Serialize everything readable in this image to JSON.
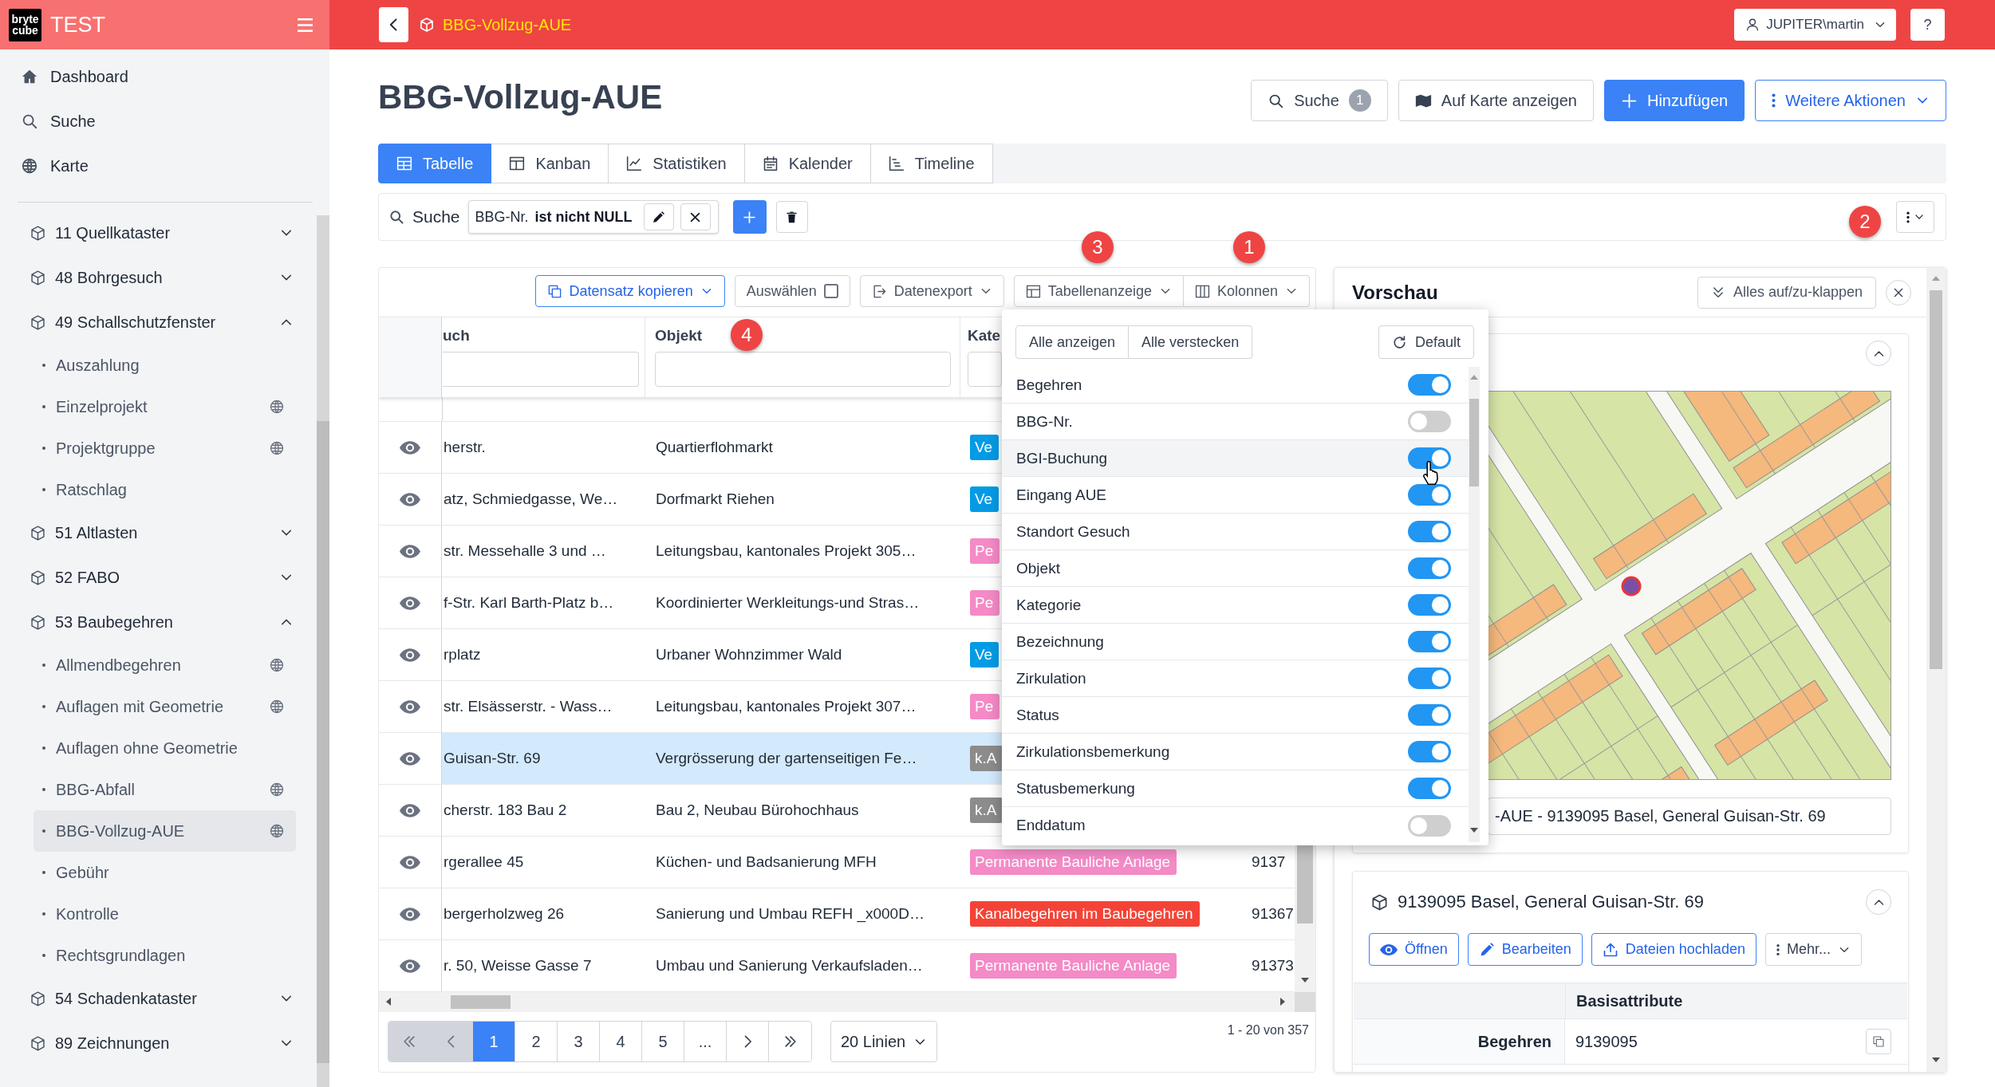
{
  "sidebar": {
    "logo": {
      "top": "bryte",
      "bottom": "cube"
    },
    "app_name": "TEST",
    "nav": [
      {
        "label": "Dashboard",
        "kind": "home"
      },
      {
        "label": "Suche",
        "kind": "search"
      },
      {
        "label": "Karte",
        "kind": "globe"
      }
    ],
    "groups": [
      {
        "label": "11 Quellkataster",
        "expanded": false
      },
      {
        "label": "48 Bohrgesuch",
        "expanded": false
      },
      {
        "label": "49 Schallschutzfenster",
        "expanded": true,
        "children": [
          {
            "label": "Auszahlung",
            "geo": false,
            "selected": false
          },
          {
            "label": "Einzelprojekt",
            "geo": true,
            "selected": false
          },
          {
            "label": "Projektgruppe",
            "geo": true,
            "selected": false
          },
          {
            "label": "Ratschlag",
            "geo": false,
            "selected": false
          }
        ]
      },
      {
        "label": "51 Altlasten",
        "expanded": false
      },
      {
        "label": "52 FABO",
        "expanded": false
      },
      {
        "label": "53 Baubegehren",
        "expanded": true,
        "children": [
          {
            "label": "Allmendbegehren",
            "geo": true,
            "selected": false
          },
          {
            "label": "Auflagen mit Geometrie",
            "geo": true,
            "selected": false
          },
          {
            "label": "Auflagen ohne Geometrie",
            "geo": false,
            "selected": false
          },
          {
            "label": "BBG-Abfall",
            "geo": true,
            "selected": false
          },
          {
            "label": "BBG-Vollzug-AUE",
            "geo": true,
            "selected": true
          },
          {
            "label": "Gebühr",
            "geo": false,
            "selected": false
          },
          {
            "label": "Kontrolle",
            "geo": false,
            "selected": false
          },
          {
            "label": "Rechtsgrundlagen",
            "geo": false,
            "selected": false
          }
        ]
      },
      {
        "label": "54 Schadenkataster",
        "expanded": false
      },
      {
        "label": "89 Zeichnungen",
        "expanded": false
      }
    ]
  },
  "topbar": {
    "title": "BBG-Vollzug-AUE",
    "user": "JUPITER\\martin",
    "help": "?"
  },
  "page": {
    "title": "BBG-Vollzug-AUE",
    "actions": [
      {
        "label": "Suche",
        "kind": "search",
        "badge": "1"
      },
      {
        "label": "Auf Karte anzeigen",
        "kind": "map"
      },
      {
        "label": "Hinzufügen",
        "kind": "add"
      },
      {
        "label": "Weitere Aktionen",
        "kind": "more"
      }
    ]
  },
  "tabs": [
    {
      "label": "Tabelle",
      "kind": "table",
      "selected": true
    },
    {
      "label": "Kanban",
      "kind": "kanban",
      "selected": false
    },
    {
      "label": "Statistiken",
      "kind": "chart",
      "selected": false
    },
    {
      "label": "Kalender",
      "kind": "calendar",
      "selected": false
    },
    {
      "label": "Timeline",
      "kind": "timeline",
      "selected": false
    }
  ],
  "search_bar": {
    "label": "Suche",
    "filters": [
      {
        "field": "BBG-Nr.",
        "condition": "ist nicht NULL"
      }
    ]
  },
  "markers": [
    {
      "label": "2"
    },
    {
      "label": "3"
    },
    {
      "label": "1"
    },
    {
      "label": "4"
    }
  ],
  "table": {
    "toolbar": [
      {
        "label": "Datensatz kopieren",
        "kind": "copy"
      },
      {
        "label": "Auswählen",
        "kind": "select",
        "checked": false
      },
      {
        "label": "Datenexport",
        "kind": "export"
      },
      {
        "label": "Tabellenanzeige",
        "kind": "view"
      },
      {
        "label": "Kolonnen",
        "kind": "columns"
      }
    ],
    "columns": [
      {
        "label": "uch"
      },
      {
        "label": "Objekt"
      },
      {
        "label": "Kate"
      }
    ],
    "rows": [
      {
        "selected": false,
        "column_1": "herstr.",
        "objekt": "Quartierflohmarkt",
        "kategorie": {
          "label": "Ve",
          "color": "#039be5"
        }
      },
      {
        "selected": false,
        "column_1": "atz, Schmiedgasse, We…",
        "objekt": "Dorfmarkt Riehen",
        "kategorie": {
          "label": "Ve",
          "color": "#039be5"
        }
      },
      {
        "selected": false,
        "column_1": "str. Messehalle 3 und …",
        "objekt": "Leitungsbau, kantonales Projekt 305…",
        "kategorie": {
          "label": "Pe",
          "color": "#f48ac6"
        }
      },
      {
        "selected": false,
        "column_1": "f-Str. Karl Barth-Platz b…",
        "objekt": "Koordinierter Werkleitungs-und Stras…",
        "kategorie": {
          "label": "Pe",
          "color": "#f48ac6"
        }
      },
      {
        "selected": false,
        "column_1": "rplatz",
        "objekt": "Urbaner Wohnzimmer Wald",
        "kategorie": {
          "label": "Ve",
          "color": "#039be5"
        }
      },
      {
        "selected": false,
        "column_1": "str. Elsässerstr. - Wass…",
        "objekt": "Leitungsbau, kantonales Projekt 307…",
        "kategorie": {
          "label": "Pe",
          "color": "#f48ac6"
        }
      },
      {
        "selected": true,
        "column_1": "Guisan-Str. 69",
        "objekt": "Vergrösserung der gartenseitigen Fe…",
        "kategorie": {
          "label": "k.A",
          "color": "#8c8c8c"
        }
      },
      {
        "selected": false,
        "column_1": "cherstr. 183 Bau 2",
        "objekt": "Bau 2, Neubau Bürohochhaus",
        "kategorie": {
          "label": "k.A",
          "color": "#8c8c8c"
        }
      },
      {
        "selected": false,
        "column_1": "rgerallee 45",
        "objekt": "Küchen- und Badsanierung MFH",
        "kategorie": {
          "label": "Permanente Bauliche Anlage",
          "color": "#f48ac6"
        },
        "column_4": "9137"
      },
      {
        "selected": false,
        "column_1": "bergerholzweg 26",
        "objekt": "Sanierung und Umbau REFH _x000D…",
        "kategorie": {
          "label": "Kanalbegehren im Baubegehren",
          "color": "#f44336"
        },
        "column_4": "91367"
      },
      {
        "selected": false,
        "column_1": "r. 50, Weisse Gasse 7",
        "objekt": "Umbau und Sanierung Verkaufsladen…",
        "kategorie": {
          "label": "Permanente Bauliche Anlage",
          "color": "#f48ac6"
        },
        "column_4": "91373"
      }
    ],
    "pagination": {
      "first": {
        "disabled": true
      },
      "prev": {
        "disabled": true
      },
      "pages": [
        {
          "label": "1",
          "selected": true
        },
        {
          "label": "2",
          "selected": false
        },
        {
          "label": "3",
          "selected": false
        },
        {
          "label": "4",
          "selected": false
        },
        {
          "label": "5",
          "selected": false
        },
        {
          "label": "...",
          "selected": false
        }
      ],
      "next": {
        "disabled": false
      },
      "last": {
        "disabled": false
      },
      "page_size": "20 Linien",
      "summary": "1 - 20 von 357"
    }
  },
  "columns_menu": {
    "show_all": "Alle anzeigen",
    "hide_all": "Alle verstecken",
    "reset": "Default",
    "items": [
      {
        "label": "Begehren",
        "on": true,
        "hovered": false
      },
      {
        "label": "BBG-Nr.",
        "on": false,
        "hovered": false
      },
      {
        "label": "BGI-Buchung",
        "on": true,
        "hovered": true
      },
      {
        "label": "Eingang AUE",
        "on": true,
        "hovered": false
      },
      {
        "label": "Standort Gesuch",
        "on": true,
        "hovered": false
      },
      {
        "label": "Objekt",
        "on": true,
        "hovered": false
      },
      {
        "label": "Kategorie",
        "on": true,
        "hovered": false
      },
      {
        "label": "Bezeichnung",
        "on": true,
        "hovered": false
      },
      {
        "label": "Zirkulation",
        "on": true,
        "hovered": false
      },
      {
        "label": "Status",
        "on": true,
        "hovered": false
      },
      {
        "label": "Zirkulationsbemerkung",
        "on": true,
        "hovered": false
      },
      {
        "label": "Statusbemerkung",
        "on": true,
        "hovered": false
      },
      {
        "label": "Enddatum",
        "on": false,
        "hovered": false
      }
    ]
  },
  "preview": {
    "title": "Vorschau",
    "toggle_all": "Alles auf/zu-klappen",
    "map_card": {
      "expanded": true,
      "caption": "-AUE - 9139095 Basel, General Guisan-Str. 69"
    },
    "record": {
      "expanded": true,
      "title": "9139095 Basel, General Guisan-Str. 69",
      "actions": [
        {
          "label": "Öffnen",
          "kind": "open"
        },
        {
          "label": "Bearbeiten",
          "kind": "edit"
        },
        {
          "label": "Dateien hochladen",
          "kind": "upload"
        },
        {
          "label": "Mehr...",
          "kind": "more"
        }
      ],
      "section": "Basisattribute",
      "attributes": [
        {
          "label": "Begehren",
          "value": "9139095"
        }
      ]
    }
  }
}
